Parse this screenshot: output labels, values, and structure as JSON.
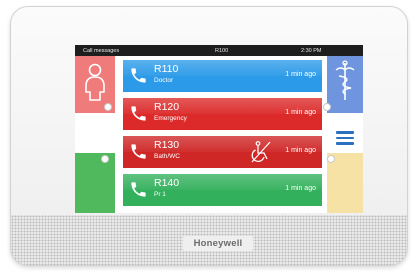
{
  "device": {
    "brand": "Honeywell"
  },
  "statusbar": {
    "left": "Call messages",
    "center": "R100",
    "right": "2:30 PM"
  },
  "tiles": {
    "left": [
      {
        "icon": "person-icon",
        "color": "#ef7b7b"
      },
      {
        "icon": "",
        "color": "#ffffff"
      },
      {
        "icon": "",
        "color": "#50b85d"
      }
    ],
    "right": [
      {
        "icon": "caduceus-icon",
        "color": "#6f95de"
      },
      {
        "icon": "menu-icon",
        "color": "#ffffff"
      },
      {
        "icon": "",
        "color": "#f7e2a6"
      }
    ]
  },
  "alerts": [
    {
      "room": "R110",
      "type": "Doctor",
      "time": "1 min ago",
      "color": "#2b9ae8",
      "icon": "phone-icon"
    },
    {
      "room": "R120",
      "type": "Emergency",
      "time": "1 min ago",
      "color": "#dc2a2a",
      "icon": "phone-icon"
    },
    {
      "room": "R130",
      "type": "Bath/WC",
      "time": "1 min ago",
      "color": "#cf2626",
      "icon": "phone-icon",
      "badge": "wheelchair-icon"
    },
    {
      "room": "R140",
      "type": "Pr 1",
      "time": "1 min ago",
      "color": "#33b05c",
      "icon": "phone-icon"
    }
  ]
}
